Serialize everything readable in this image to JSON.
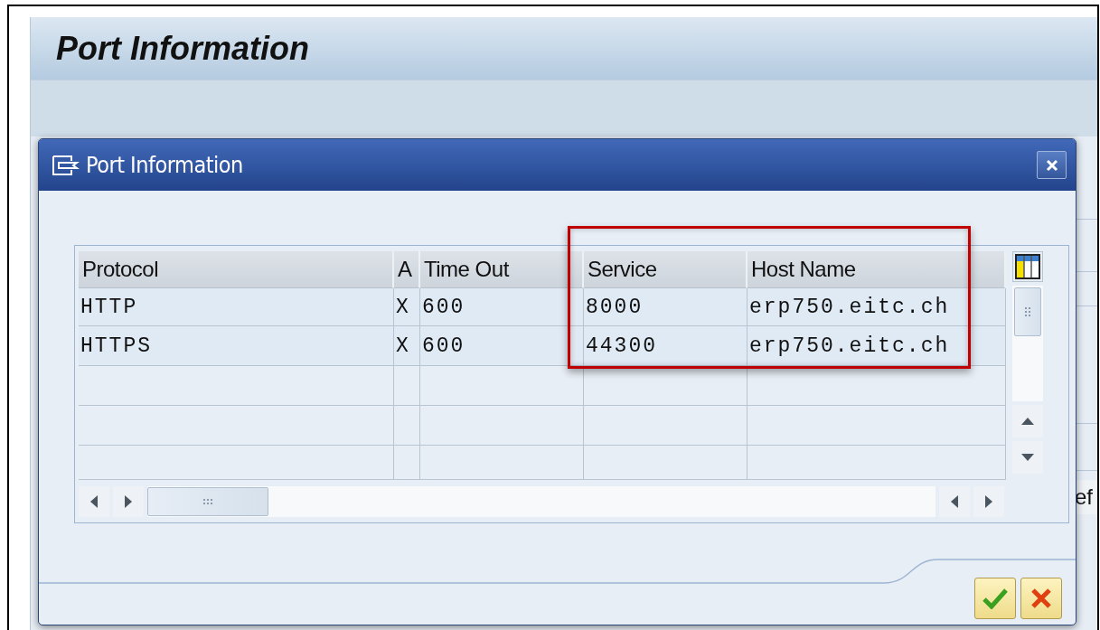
{
  "app": {
    "title": "Port Information",
    "background_field_text": "ef"
  },
  "dialog": {
    "title": "Port Information",
    "table": {
      "columns": [
        "Protocol",
        "A",
        "Time Out",
        "Service",
        "Host Name"
      ],
      "rows": [
        {
          "cells": [
            "HTTP",
            "X",
            "600",
            "8000",
            "erp750.eitc.ch"
          ]
        },
        {
          "cells": [
            "HTTPS",
            "X",
            "600",
            "44300",
            "erp750.eitc.ch"
          ]
        }
      ]
    }
  }
}
